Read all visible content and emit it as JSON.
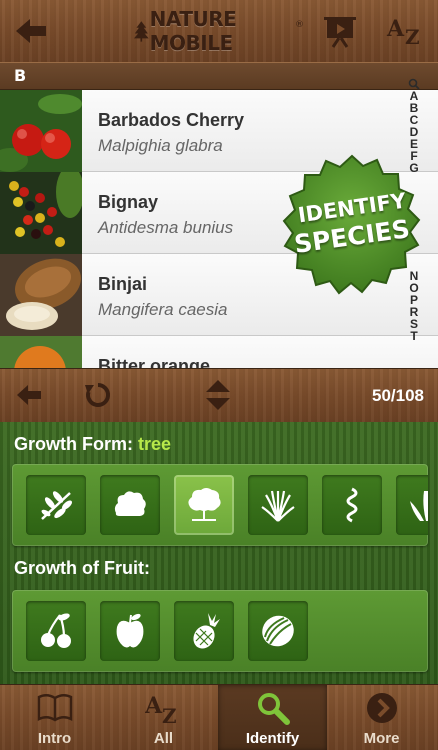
{
  "header": {
    "brand": "NATURE MOBILE",
    "reg": "®",
    "colors": {
      "wood": "#7a4c2b",
      "brand_text": "#3a2012"
    }
  },
  "section": {
    "letter": "B"
  },
  "list": {
    "items": [
      {
        "name": "Barbados Cherry",
        "latin": "Malpighia glabra"
      },
      {
        "name": "Bignay",
        "latin": "Antidesma bunius"
      },
      {
        "name": "Binjai",
        "latin": "Mangifera caesia"
      },
      {
        "name": "Bitter orange",
        "latin": ""
      }
    ]
  },
  "index": {
    "letters_a": [
      "A",
      "B",
      "C",
      "D",
      "E",
      "F",
      "G"
    ],
    "letters_b": [
      "N",
      "O",
      "P",
      "R",
      "S",
      "T"
    ]
  },
  "badge": {
    "line1": "IDENTIFY",
    "line2": "SPECIES",
    "color": "#4f8f2a"
  },
  "navbar": {
    "counter": "50/108"
  },
  "filters": {
    "growth_form": {
      "label": "Growth Form:",
      "value": "tree",
      "options": [
        "branch-icon",
        "shrub-icon",
        "tree-icon",
        "grass-icon",
        "vine-icon",
        "aloe-icon"
      ],
      "selected": "tree-icon"
    },
    "growth_of_fruit": {
      "label": "Growth of Fruit:",
      "options": [
        "cherry-icon",
        "apple-icon",
        "pineapple-icon",
        "melon-icon"
      ]
    },
    "colors": {
      "highlight": "#b7e84a",
      "panel": "#2f5a1a"
    }
  },
  "tabs": [
    {
      "label": "Intro",
      "icon": "book-icon"
    },
    {
      "label": "All",
      "icon": "az-icon"
    },
    {
      "label": "Identify",
      "icon": "magnifier-icon",
      "active": true
    },
    {
      "label": "More",
      "icon": "more-arrow-icon"
    }
  ]
}
